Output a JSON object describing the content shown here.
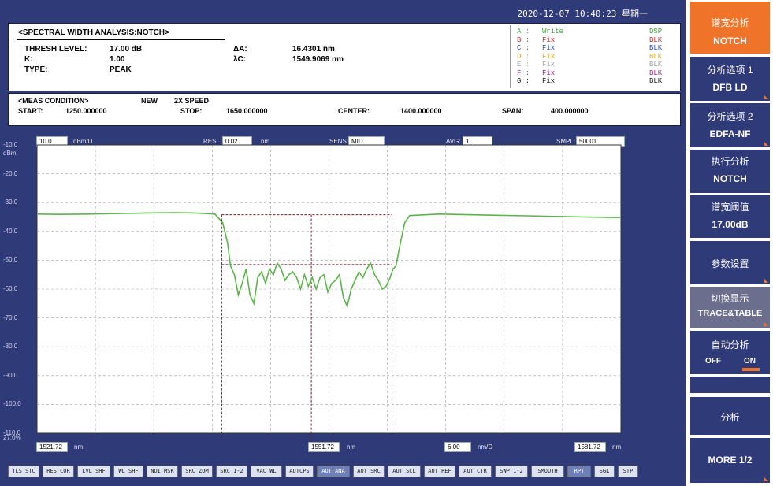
{
  "timestamp": "2020-12-07 10:40:23 星期一",
  "analysis": {
    "title": "<SPECTRAL WIDTH ANALYSIS:NOTCH>",
    "thresh_label": "THRESH LEVEL:",
    "thresh_value": "17.00 dB",
    "k_label": "K:",
    "k_value": "1.00",
    "type_label": "TYPE:",
    "type_value": "PEAK",
    "delta_lambda_label": "ΔA:",
    "delta_lambda_value": "16.4301 nm",
    "center_lambda_label": "λC:",
    "center_lambda_value": "1549.9069 nm"
  },
  "traces": [
    {
      "letter": "A :",
      "mode": "Write",
      "disp": "DSP",
      "color": "#3aa63a",
      "disp_color": "#3aa63a"
    },
    {
      "letter": "B :",
      "mode": "Fix",
      "disp": "BLK",
      "color": "#d03030",
      "disp_color": "#d03030"
    },
    {
      "letter": "C :",
      "mode": "Fix",
      "disp": "BLK",
      "color": "#2a4fd0",
      "disp_color": "#2a4fd0"
    },
    {
      "letter": "D :",
      "mode": "Fix",
      "disp": "BLK",
      "color": "#d9a528",
      "disp_color": "#d9a528"
    },
    {
      "letter": "E :",
      "mode": "Fix",
      "disp": "BLK",
      "color": "#9aa3a8",
      "disp_color": "#9aa3a8"
    },
    {
      "letter": "F :",
      "mode": "Fix",
      "disp": "BLK",
      "color": "#a02a8a",
      "disp_color": "#a02a8a"
    },
    {
      "letter": "G :",
      "mode": "Fix",
      "disp": "BLK",
      "color": "#222222",
      "disp_color": "#222222"
    }
  ],
  "meas": {
    "title": "<MEAS CONDITION>",
    "new": "NEW",
    "speed": "2X SPEED",
    "start_label": "START:",
    "start_value": "1250.000000",
    "stop_label": "STOP:",
    "stop_value": "1650.000000",
    "center_label": "CENTER:",
    "center_value": "1400.000000",
    "span_label": "SPAN:",
    "span_value": "400.000000"
  },
  "plot_header": {
    "ref_value": "10.0",
    "ref_unit": "dBm/D",
    "res_label": "RES:",
    "res_value": "0.02",
    "res_unit": "nm",
    "sens_label": "SENS:",
    "sens_value": "MID",
    "avg_label": "AVG:",
    "avg_value": "1",
    "smpl_label": "SMPL:",
    "smpl_value": "50001"
  },
  "y_axis": {
    "top": "-10.0",
    "unit": "dBm",
    "ticks": [
      "-20.0",
      "-30.0",
      "-40.0",
      "-50.0",
      "-60.0",
      "-70.0",
      "-80.0",
      "-90.0",
      "-100.0",
      "-110.0"
    ],
    "bottom_extra": "27.0%"
  },
  "plot_footer": {
    "start_value": "1521.72",
    "start_unit": "nm",
    "center_value": "1551.72",
    "center_unit": "nm",
    "div_value": "6.00",
    "div_unit": "nm/D",
    "stop_value": "1581.72",
    "stop_unit": "nm"
  },
  "bottom_buttons": [
    {
      "label": "TLS STC",
      "active": false
    },
    {
      "label": "RES COR",
      "active": false
    },
    {
      "label": "LVL SHF",
      "active": false
    },
    {
      "label": "WL SHF",
      "active": false
    },
    {
      "label": "NOI MSK",
      "active": false
    },
    {
      "label": "SRC ZOM",
      "active": false
    },
    {
      "label": "SRC 1-2",
      "active": false
    },
    {
      "label": "VAC WL",
      "active": false
    },
    {
      "label": "AUTCPS",
      "active": false
    },
    {
      "label": "AUT ANA",
      "active": true
    },
    {
      "label": "AUT SRC",
      "active": false
    },
    {
      "label": "AUT SCL",
      "active": false
    },
    {
      "label": "AUT REF",
      "active": false
    },
    {
      "label": "AUT CTR",
      "active": false
    },
    {
      "label": "SWP 1-2",
      "active": false
    },
    {
      "label": "SMOOTH",
      "active": false
    },
    {
      "label": "RPT",
      "active": true
    },
    {
      "label": "SGL",
      "active": false
    },
    {
      "label": "STP",
      "active": false
    }
  ],
  "softkeys": {
    "k1_l1": "谱宽分析",
    "k1_l2": "NOTCH",
    "k2_l1": "分析选项 1",
    "k2_l2": "DFB LD",
    "k3_l1": "分析选项 2",
    "k3_l2": "EDFA-NF",
    "k4_l1": "执行分析",
    "k4_l2": "NOTCH",
    "k5_l1": "谱宽阈值",
    "k5_l2": "17.00dB",
    "k6_l1": "参数设置",
    "k7_l1": "切换显示",
    "k7_l2": "TRACE&TABLE",
    "k8_l1": "自动分析",
    "k8_off": "OFF",
    "k8_on": "ON",
    "k9_l1": "分析",
    "k10_l1": "MORE 1/2"
  },
  "colors": {
    "background": "#2f3a78",
    "trace": "#5cb54a",
    "marker": "#7a1f2a",
    "accent": "#f0732a"
  },
  "chart_data": {
    "type": "line",
    "title": "",
    "xlabel": "nm",
    "ylabel": "dBm",
    "xlim": [
      1521.72,
      1581.72
    ],
    "ylim": [
      -110.0,
      -10.0
    ],
    "grid": true,
    "series": [
      {
        "x": [
          1521.72,
          1524,
          1527,
          1530,
          1533,
          1536,
          1538,
          1540,
          1540.8,
          1541.3,
          1541.6,
          1542.0,
          1542.4,
          1542.8,
          1543.2,
          1543.6,
          1544.0,
          1544.4,
          1544.8,
          1545.2,
          1545.6,
          1546.0,
          1546.4,
          1546.8,
          1547.2,
          1547.6,
          1548.0,
          1548.4,
          1548.8,
          1549.2,
          1549.6,
          1550.0,
          1550.4,
          1550.8,
          1551.2,
          1551.6,
          1552.0,
          1552.4,
          1552.8,
          1553.2,
          1553.6,
          1554.0,
          1554.4,
          1554.8,
          1555.2,
          1555.6,
          1556.0,
          1556.4,
          1556.8,
          1557.2,
          1557.6,
          1558.0,
          1558.3,
          1558.6,
          1559.0,
          1559.5,
          1560,
          1563,
          1566,
          1569,
          1572,
          1575,
          1578,
          1581.72
        ],
        "y": [
          -34.0,
          -34.1,
          -34.0,
          -33.8,
          -33.6,
          -33.5,
          -33.6,
          -34.0,
          -37,
          -44,
          -52,
          -55,
          -62,
          -58,
          -53,
          -62,
          -65,
          -56,
          -54,
          -58,
          -53,
          -55,
          -51,
          -53,
          -57,
          -55,
          -54,
          -56,
          -60,
          -55,
          -59,
          -56,
          -60,
          -56,
          -55,
          -61,
          -58,
          -57,
          -55,
          -63,
          -66,
          -60,
          -57,
          -54,
          -56,
          -53,
          -51,
          -55,
          -57,
          -60,
          -59,
          -56,
          -53,
          -52,
          -45,
          -37,
          -34.5,
          -34.0,
          -34.2,
          -34.4,
          -34.6,
          -34.8,
          -35.0,
          -35.2
        ]
      }
    ],
    "annotations": {
      "notch_left_x": 1540.7,
      "notch_right_x": 1558.2,
      "center_x": 1549.9069,
      "threshold_y": -51.5,
      "top_y": -34.2
    }
  }
}
